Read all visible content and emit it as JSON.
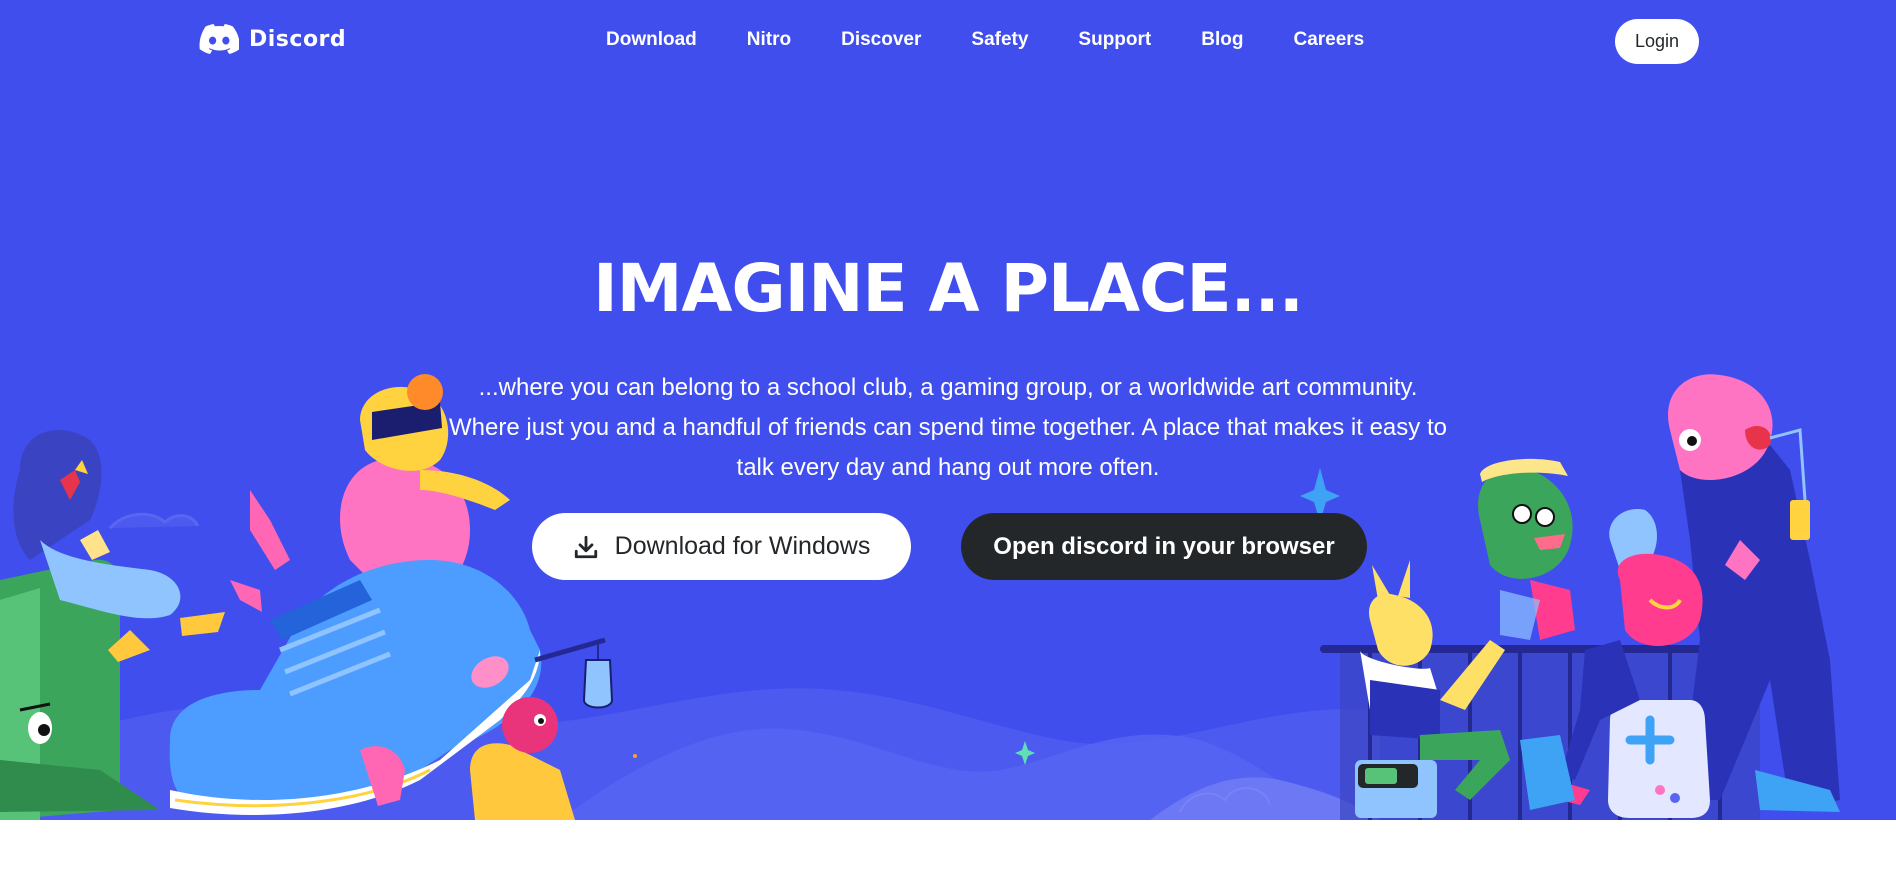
{
  "brand": {
    "name": "Discord",
    "hero_color": "#404eed",
    "dark_color": "#23272a"
  },
  "nav": {
    "links": [
      "Download",
      "Nitro",
      "Discover",
      "Safety",
      "Support",
      "Blog",
      "Careers"
    ],
    "login_label": "Login"
  },
  "hero": {
    "headline": "IMAGINE A PLACE...",
    "subtitle": "...where you can belong to a school club, a gaming group, or a worldwide art community. Where just you and a handful of friends can spend time together. A place that makes it easy to talk every day and hang out more often."
  },
  "cta": {
    "download_label": "Download for Windows",
    "download_icon": "download-icon",
    "browser_label": "Open discord in your browser"
  }
}
